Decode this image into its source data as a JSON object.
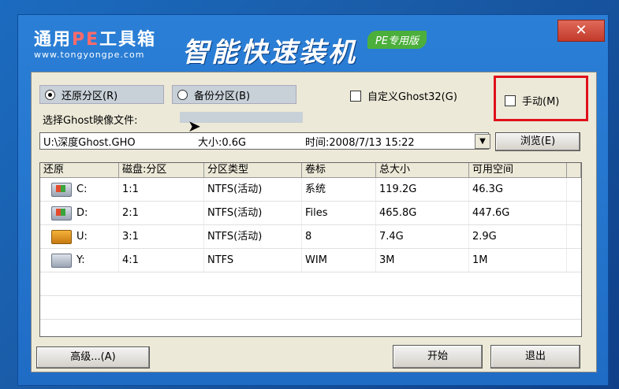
{
  "window": {
    "brand_title_a": "通用",
    "brand_title_pe": "PE",
    "brand_title_b": "工具箱",
    "brand_url": "www.tongyongpe.com",
    "app_title": "智能快速装机",
    "edition_badge": "PE专用版",
    "close_symbol": "✕"
  },
  "options": {
    "restore_radio": "还原分区(R)",
    "backup_radio": "备份分区(B)",
    "custom_ghost_checkbox": "自定义Ghost32(G)",
    "manual_checkbox": "手动(M)"
  },
  "file": {
    "select_label": "选择Ghost映像文件:",
    "path": "U:\\深度Ghost.GHO",
    "size": "大小:0.6G",
    "time": "时间:2008/7/13 15:22",
    "browse_button": "浏览(E)"
  },
  "table": {
    "headers": [
      "还原",
      "磁盘:分区",
      "分区类型",
      "卷标",
      "总大小",
      "可用空间"
    ],
    "rows": [
      {
        "drive": "C:",
        "icon": "windows-drive-icon",
        "disk": "1:1",
        "type": "NTFS(活动)",
        "label": "系统",
        "total": "119.2G",
        "free": "46.3G"
      },
      {
        "drive": "D:",
        "icon": "windows-drive-icon",
        "disk": "2:1",
        "type": "NTFS(活动)",
        "label": "Files",
        "total": "465.8G",
        "free": "447.6G"
      },
      {
        "drive": "U:",
        "icon": "usb-drive-icon",
        "disk": "3:1",
        "type": "NTFS(活动)",
        "label": "8",
        "total": "7.4G",
        "free": "2.9G"
      },
      {
        "drive": "Y:",
        "icon": "disk-drive-icon",
        "disk": "4:1",
        "type": "NTFS",
        "label": "WIM",
        "total": "3M",
        "free": "1M"
      }
    ]
  },
  "footer": {
    "advanced_button": "高级...(A)",
    "start_button": "开始",
    "exit_button": "退出"
  },
  "colors": {
    "highlight_border": "#e0101a",
    "close_button": "#c23a2a",
    "window_blue": "#1f6cc5"
  }
}
